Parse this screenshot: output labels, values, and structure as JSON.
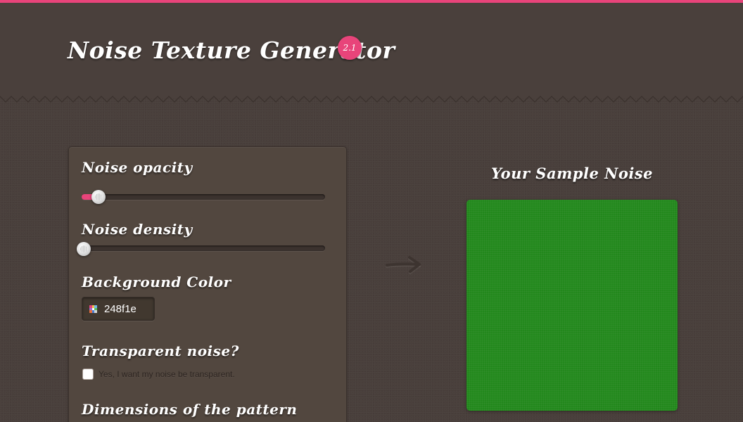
{
  "theme": {
    "background": "#493f3b",
    "accent": "#e8447a",
    "panel": "#52473f"
  },
  "header": {
    "title": "Noise Texture Generator",
    "version": "2.1"
  },
  "controls": {
    "noise_opacity": {
      "label": "Noise opacity",
      "value_fraction": 0.07
    },
    "noise_density": {
      "label": "Noise density",
      "value_fraction": 0.0
    },
    "background_color": {
      "label": "Background Color",
      "value": "248f1e",
      "icon": "color-picker-icon"
    },
    "transparent_noise": {
      "label": "Transparent noise?",
      "checkbox_label": "Yes, I want my noise be transparent.",
      "checked": false
    },
    "dimensions": {
      "label": "Dimensions of the pattern"
    }
  },
  "arrow_icon": "right-arrow-icon",
  "preview": {
    "title": "Your Sample Noise",
    "color": "#248f1e"
  }
}
